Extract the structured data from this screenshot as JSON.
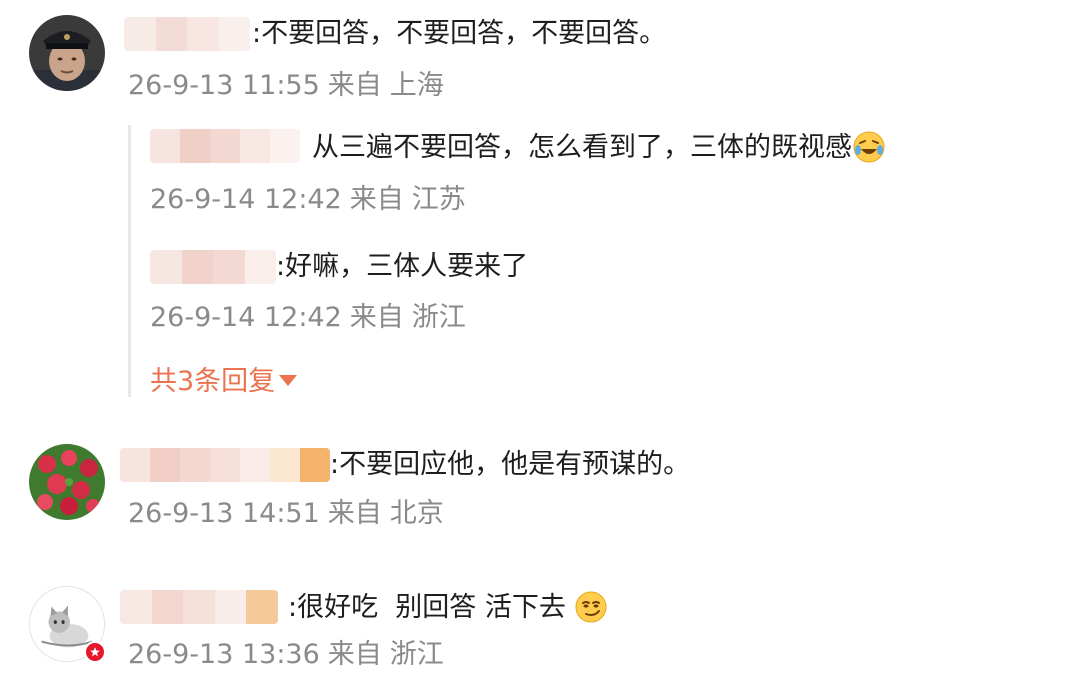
{
  "comments": [
    {
      "separator": ":",
      "text": "不要回答，不要回答，不要回答。",
      "date": "26-9-13 11:55",
      "from_label": "来自",
      "location": "上海",
      "avatar_icon": "soldier-avatar-icon",
      "replies": [
        {
          "separator": "",
          "text": "从三遍不要回答，怎么看到了，三体的既视感",
          "emoji": "laugh-cry-emoji-icon",
          "date": "26-9-14 12:42",
          "from_label": "来自",
          "location": "江苏"
        },
        {
          "separator": ":",
          "text": "好嘛，三体人要来了",
          "date": "26-9-14 12:42",
          "from_label": "来自",
          "location": "浙江"
        }
      ],
      "more_replies_label": "共3条回复"
    },
    {
      "separator": ":",
      "text": "不要回应他，他是有预谋的。",
      "date": "26-9-13 14:51",
      "from_label": "来自",
      "location": "北京",
      "avatar_icon": "flowers-avatar-icon"
    },
    {
      "separator": ":",
      "text": "很好吃  别回答 活下去",
      "emoji": "smirk-emoji-icon",
      "date": "26-9-13 13:36",
      "from_label": "来自",
      "location": "浙江",
      "avatar_icon": "cat-avatar-icon",
      "badge_icon": "verified-badge-icon"
    }
  ],
  "colors": {
    "more_link": "#eb7350",
    "meta_text": "#8a8a8a",
    "badge": "#e6162d"
  }
}
